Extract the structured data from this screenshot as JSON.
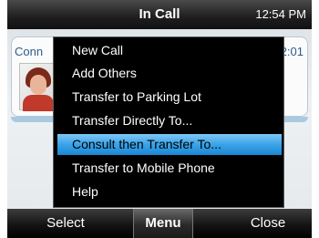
{
  "status_bar": {
    "title": "In Call",
    "clock": "12:54 PM"
  },
  "call_card": {
    "label": "Conn",
    "time": "2:01"
  },
  "menu": {
    "items": [
      {
        "label": "New Call"
      },
      {
        "label": "Add Others"
      },
      {
        "label": "Transfer to Parking Lot"
      },
      {
        "label": "Transfer Directly To..."
      },
      {
        "label": "Consult then Transfer To...",
        "selected": true
      },
      {
        "label": "Transfer to Mobile Phone"
      },
      {
        "label": "Help"
      }
    ]
  },
  "softkeys": {
    "left": "Select",
    "center": "Menu",
    "right": "Close"
  },
  "colors": {
    "highlight": "#3aa3e8",
    "card_text": "#2c5d8a"
  }
}
